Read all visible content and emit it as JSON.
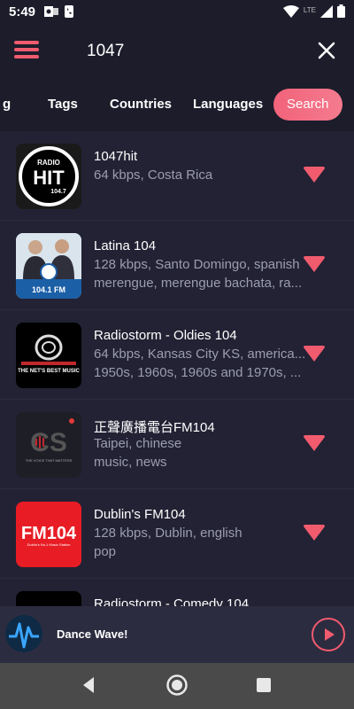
{
  "status_bar": {
    "time": "5:49",
    "network": "LTE",
    "icons": [
      "outlook-icon",
      "phone-icon",
      "wifi-icon",
      "signal-icon",
      "battery-icon"
    ]
  },
  "app_bar": {
    "menu_icon": "hamburger-menu-icon",
    "search_query": "1047",
    "close_icon": "close-icon"
  },
  "tabs": [
    {
      "label": "g"
    },
    {
      "label": "Tags"
    },
    {
      "label": "Countries"
    },
    {
      "label": "Languages"
    },
    {
      "label": "Search",
      "active": true
    }
  ],
  "stations": [
    {
      "title": "1047hit",
      "line1": "64 kbps, Costa Rica",
      "line2": ""
    },
    {
      "title": "Latina 104",
      "line1": "128 kbps, Santo Domingo, spanish",
      "line2": "merengue, merengue bachata, ra..."
    },
    {
      "title": "Radiostorm - Oldies 104",
      "line1": "64 kbps, Kansas City KS, america...",
      "line2": "1950s, 1960s, 1960s and 1970s, ..."
    },
    {
      "title": "正聲廣播電台FM104",
      "line1": "Taipei, chinese",
      "line2": "music, news"
    },
    {
      "title": "Dublin's FM104",
      "line1": "128 kbps, Dublin, english",
      "line2": "pop"
    },
    {
      "title": "Radiostorm - Comedy 104",
      "line1": "",
      "line2": ""
    }
  ],
  "thumbnails": {
    "hit_top": "RADIO",
    "hit_main": "HIT",
    "hit_freq": "104.7",
    "latina_freq": "104.1 FM",
    "radiostorm_tag": "THE NET'S BEST MUSIC",
    "cs_logo": "CS",
    "cs_tagline": "THE VOICE THAT MATTERS",
    "fm104_logo": "FM104",
    "fm104_tagline": "Dublin's No.1 Music Station"
  },
  "player": {
    "station_name": "Dance Wave!",
    "play_icon": "play-icon"
  },
  "nav_bar": {
    "back_icon": "back-triangle-icon",
    "home_icon": "home-circle-icon",
    "recents_icon": "recents-square-icon"
  },
  "colors": {
    "accent": "#f15b6e",
    "background": "#1c1c2b",
    "list_background": "#222234",
    "secondary_text": "#9d9db0"
  }
}
